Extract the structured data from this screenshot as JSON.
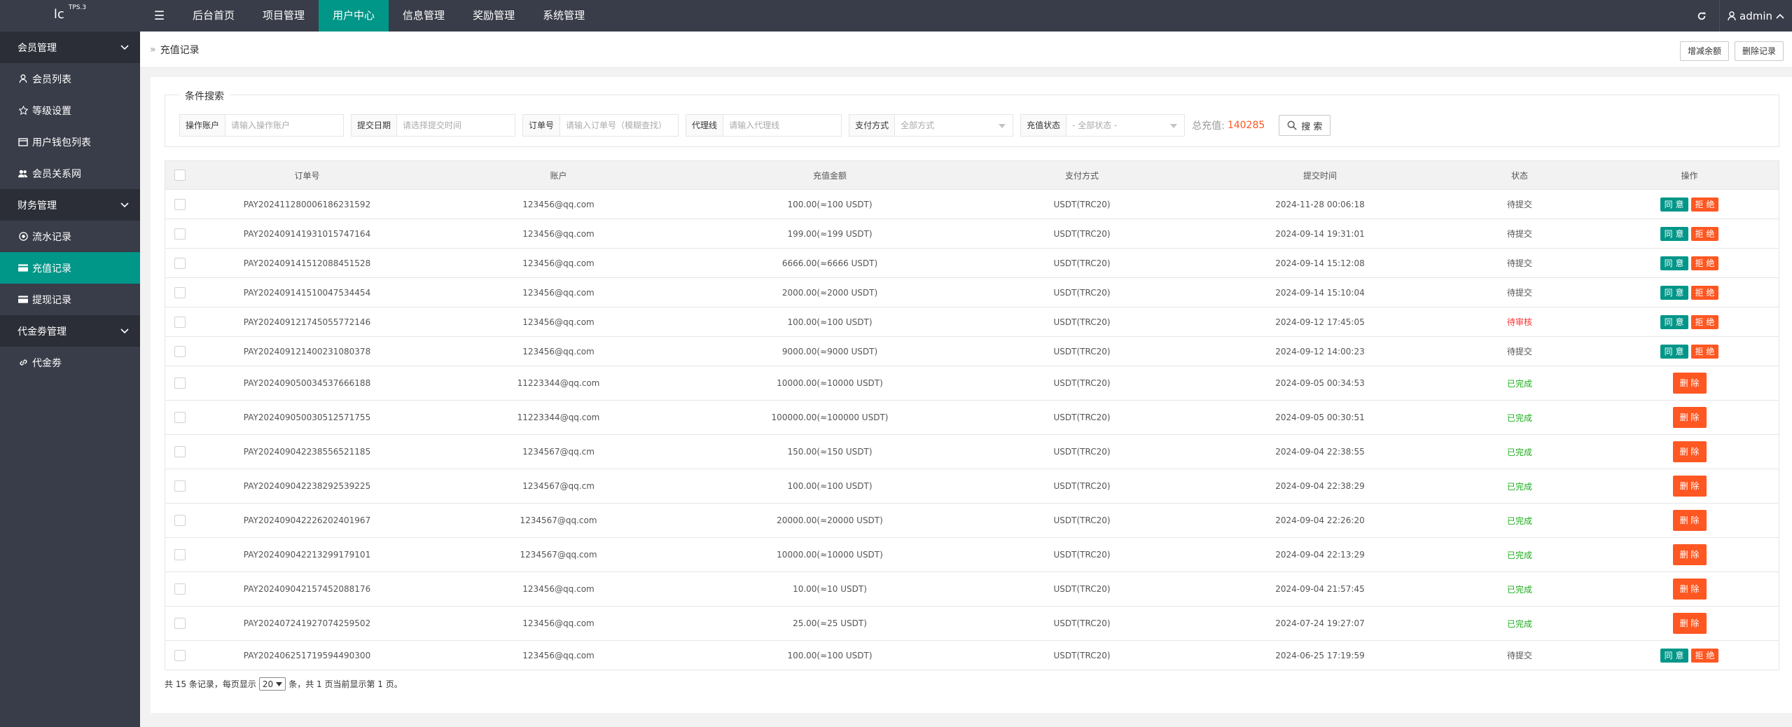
{
  "app": {
    "logo_text": "lc",
    "logo_sup": "TPS.3",
    "menu_icon": "☰"
  },
  "topnav": {
    "items": [
      {
        "label": "后台首页"
      },
      {
        "label": "项目管理"
      },
      {
        "label": "用户中心",
        "active": true
      },
      {
        "label": "信息管理"
      },
      {
        "label": "奖励管理"
      },
      {
        "label": "系统管理"
      }
    ],
    "user_name": "admin"
  },
  "sidebar": {
    "groups": [
      {
        "label": "会员管理",
        "items": [
          {
            "label": "会员列表",
            "icon": "user-icon"
          },
          {
            "label": "等级设置",
            "icon": "star-icon"
          },
          {
            "label": "用户钱包列表",
            "icon": "wallet-icon"
          },
          {
            "label": "会员关系网",
            "icon": "users-icon"
          }
        ]
      },
      {
        "label": "财务管理",
        "items": [
          {
            "label": "流水记录",
            "icon": "coin-icon"
          },
          {
            "label": "充值记录",
            "icon": "card-icon",
            "active": true
          },
          {
            "label": "提现记录",
            "icon": "card-icon"
          }
        ]
      },
      {
        "label": "代金劵管理",
        "items": [
          {
            "label": "代金劵",
            "icon": "link-icon"
          }
        ]
      }
    ]
  },
  "breadcrumb": {
    "separator": "»",
    "title": "充值记录",
    "add_balance_label": "增减余额",
    "delete_records_label": "删除记录"
  },
  "search": {
    "legend": "条件搜索",
    "fields": {
      "account": {
        "label": "操作账户",
        "placeholder": "请输入操作账户"
      },
      "date": {
        "label": "提交日期",
        "placeholder": "请选择提交时间"
      },
      "order": {
        "label": "订单号",
        "placeholder": "请输入订单号（模糊查找）"
      },
      "agent": {
        "label": "代理线",
        "placeholder": "请输入代理线"
      },
      "pay_method": {
        "label": "支付方式",
        "value": "全部方式"
      },
      "status": {
        "label": "充值状态",
        "value": "- 全部状态 -"
      }
    },
    "total_label": "总充值:",
    "total_value": "140285",
    "button_label": "搜 索"
  },
  "table": {
    "headers": [
      "订单号",
      "账户",
      "充值金额",
      "支付方式",
      "提交时间",
      "状态",
      "操作"
    ],
    "agree_label": "同 意",
    "reject_label": "拒 绝",
    "delete_label": "删 除",
    "rows": [
      {
        "order": "PAY20241128000618623​1592",
        "account": "123456@qq.com",
        "amount": "100.00(≈100 USDT)",
        "pay": "USDT(TRC20)",
        "time": "2024-11-28 00:06:18",
        "status": "待提交",
        "status_type": "pending",
        "ops": "review"
      },
      {
        "order": "PAY202409141931015747164",
        "account": "123456@qq.com",
        "amount": "199.00(≈199 USDT)",
        "pay": "USDT(TRC20)",
        "time": "2024-09-14 19:31:01",
        "status": "待提交",
        "status_type": "pending",
        "ops": "review"
      },
      {
        "order": "PAY202409141512088451528",
        "account": "123456@qq.com",
        "amount": "6666.00(≈6666 USDT)",
        "pay": "USDT(TRC20)",
        "time": "2024-09-14 15:12:08",
        "status": "待提交",
        "status_type": "pending",
        "ops": "review"
      },
      {
        "order": "PAY202409141510047534454",
        "account": "123456@qq.com",
        "amount": "2000.00(≈2000 USDT)",
        "pay": "USDT(TRC20)",
        "time": "2024-09-14 15:10:04",
        "status": "待提交",
        "status_type": "pending",
        "ops": "review"
      },
      {
        "order": "PAY202409121745055772146",
        "account": "123456@qq.com",
        "amount": "100.00(≈100 USDT)",
        "pay": "USDT(TRC20)",
        "time": "2024-09-12 17:45:05",
        "status": "待审核",
        "status_type": "review",
        "ops": "review"
      },
      {
        "order": "PAY202409121400231080378",
        "account": "123456@qq.com",
        "amount": "9000.00(≈9000 USDT)",
        "pay": "USDT(TRC20)",
        "time": "2024-09-12 14:00:23",
        "status": "待提交",
        "status_type": "pending",
        "ops": "review"
      },
      {
        "order": "PAY202409050034537666188",
        "account": "11223344@qq.com",
        "amount": "10000.00(≈10000 USDT)",
        "pay": "USDT(TRC20)",
        "time": "2024-09-05 00:34:53",
        "status": "已完成",
        "status_type": "done",
        "ops": "delete"
      },
      {
        "order": "PAY202409050030512571755",
        "account": "11223344@qq.com",
        "amount": "100000.00(≈100000 USDT)",
        "pay": "USDT(TRC20)",
        "time": "2024-09-05 00:30:51",
        "status": "已完成",
        "status_type": "done",
        "ops": "delete"
      },
      {
        "order": "PAY202409042238556521185",
        "account": "1234567@qq.cm",
        "amount": "150.00(≈150 USDT)",
        "pay": "USDT(TRC20)",
        "time": "2024-09-04 22:38:55",
        "status": "已完成",
        "status_type": "done",
        "ops": "delete"
      },
      {
        "order": "PAY202409042238292539225",
        "account": "1234567@qq.cm",
        "amount": "100.00(≈100 USDT)",
        "pay": "USDT(TRC20)",
        "time": "2024-09-04 22:38:29",
        "status": "已完成",
        "status_type": "done",
        "ops": "delete"
      },
      {
        "order": "PAY202409042226202401967",
        "account": "1234567@qq.com",
        "amount": "20000.00(≈20000 USDT)",
        "pay": "USDT(TRC20)",
        "time": "2024-09-04 22:26:20",
        "status": "已完成",
        "status_type": "done",
        "ops": "delete"
      },
      {
        "order": "PAY202409042213299179101",
        "account": "1234567@qq.com",
        "amount": "10000.00(≈10000 USDT)",
        "pay": "USDT(TRC20)",
        "time": "2024-09-04 22:13:29",
        "status": "已完成",
        "status_type": "done",
        "ops": "delete"
      },
      {
        "order": "PAY202409042157452088176",
        "account": "123456@qq.com",
        "amount": "10.00(≈10 USDT)",
        "pay": "USDT(TRC20)",
        "time": "2024-09-04 21:57:45",
        "status": "已完成",
        "status_type": "done",
        "ops": "delete"
      },
      {
        "order": "PAY202407241927074259502",
        "account": "123456@qq.com",
        "amount": "25.00(≈25 USDT)",
        "pay": "USDT(TRC20)",
        "time": "2024-07-24 19:27:07",
        "status": "已完成",
        "status_type": "done",
        "ops": "delete"
      },
      {
        "order": "PAY202406251719594490300",
        "account": "123456@qq.com",
        "amount": "100.00(≈100 USDT)",
        "pay": "USDT(TRC20)",
        "time": "2024-06-25 17:19:59",
        "status": "待提交",
        "status_type": "pending",
        "ops": "review"
      }
    ]
  },
  "pager": {
    "prefix": "共 15 条记录，每页显示",
    "page_size": "20",
    "suffix": "条，共 1 页当前显示第 1 页。"
  }
}
